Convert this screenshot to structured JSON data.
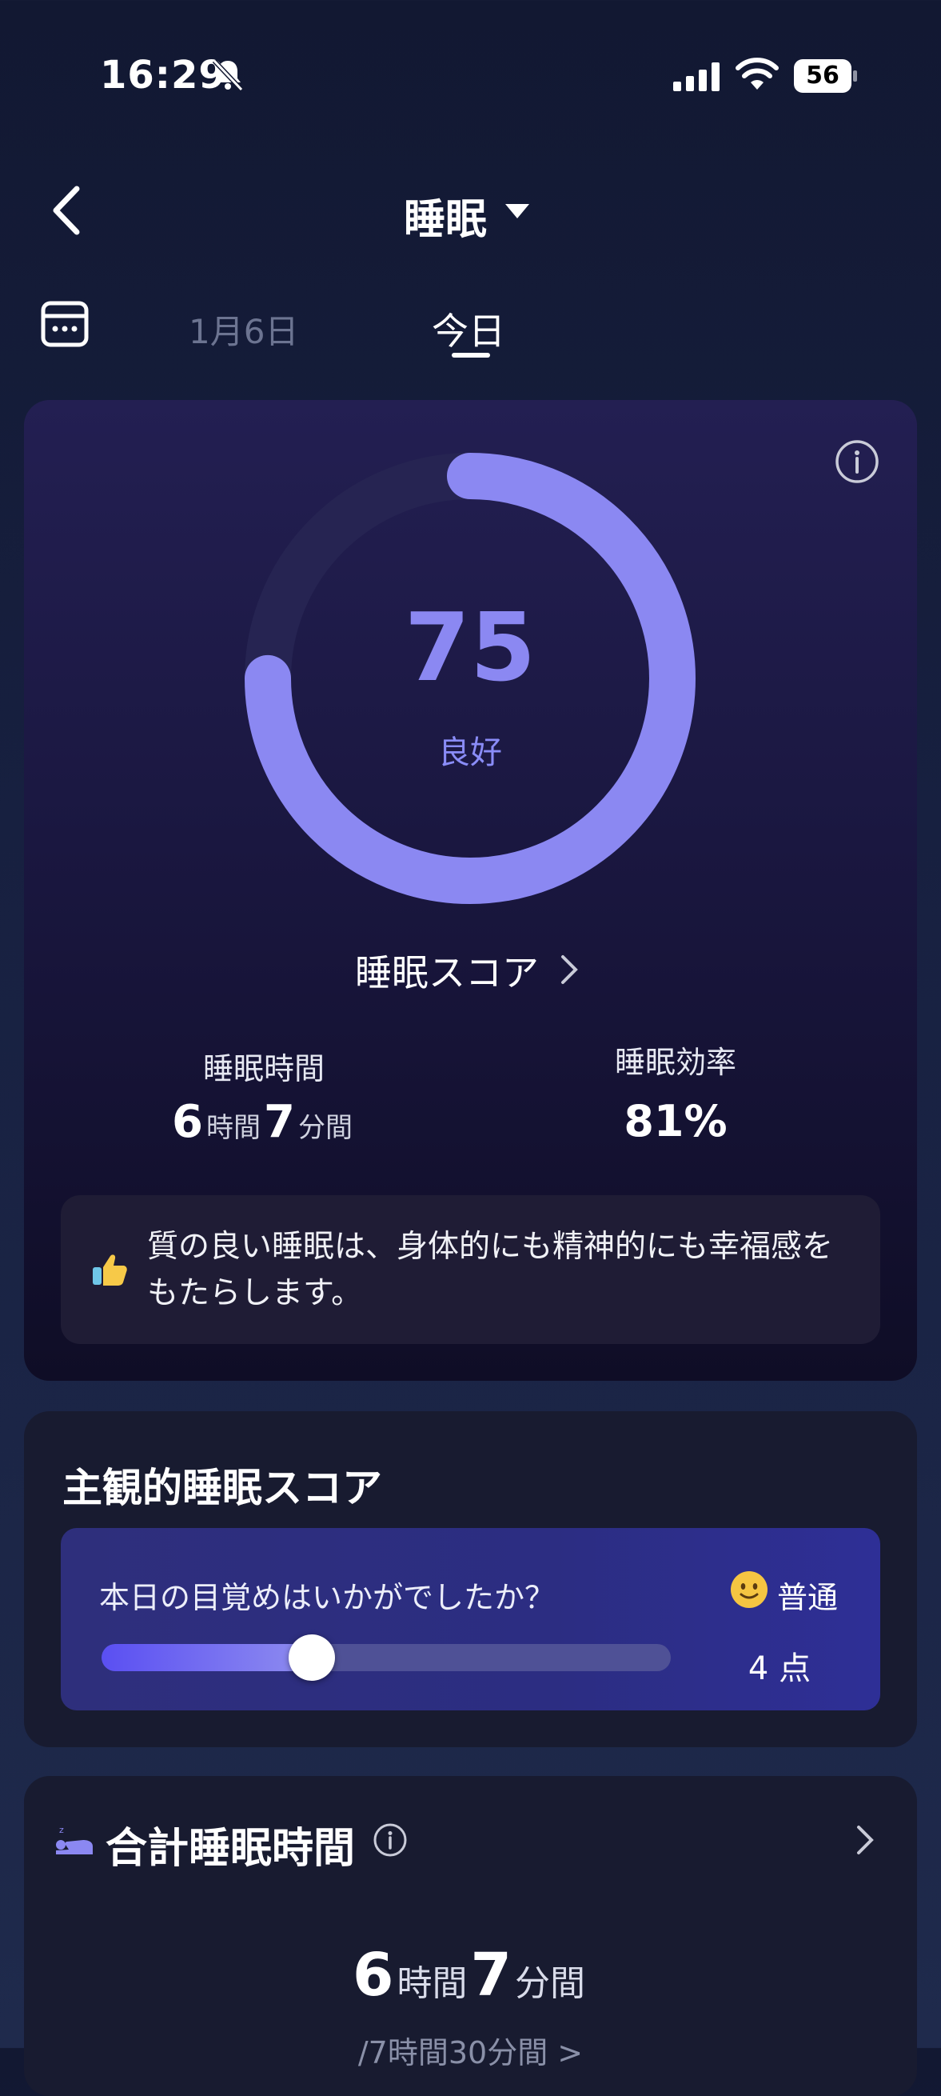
{
  "status_bar": {
    "time": "16:29",
    "battery": "56"
  },
  "header": {
    "title": "睡眠"
  },
  "tabs": [
    {
      "label": "1月6日"
    },
    {
      "label": "今日"
    }
  ],
  "score_card": {
    "score": "75",
    "score_label": "良好",
    "score_value": 75,
    "score_link": "睡眠スコア",
    "metrics": {
      "duration_label": "睡眠時間",
      "duration_hours": "6",
      "duration_hours_unit": "時間",
      "duration_minutes": "7",
      "duration_minutes_unit": "分間",
      "efficiency_label": "睡眠効率",
      "efficiency_value": "81%"
    },
    "tip": "質の良い睡眠は、身体的にも精神的にも幸福感をもたらします。"
  },
  "subjective": {
    "title": "主観的睡眠スコア",
    "question": "本日の目覚めはいかがでしたか？",
    "mood": "普通",
    "points": "4 点",
    "slider_fraction": 0.37
  },
  "total_sleep": {
    "title": "合計睡眠時間",
    "hours": "6",
    "hours_unit": "時間",
    "minutes": "7",
    "minutes_unit": "分間",
    "sub": "/7時間30分間 >"
  },
  "colors": {
    "accent": "#8b88f2",
    "ring_track": "#262452",
    "background": "#151b36"
  },
  "icons": [
    "bell-off-icon",
    "signal-icon",
    "wifi-icon",
    "battery-icon",
    "back-arrow-icon",
    "dropdown-caret-icon",
    "calendar-icon",
    "info-icon",
    "chevron-right-icon",
    "thumbs-up-icon",
    "smile-icon",
    "bed-icon"
  ]
}
